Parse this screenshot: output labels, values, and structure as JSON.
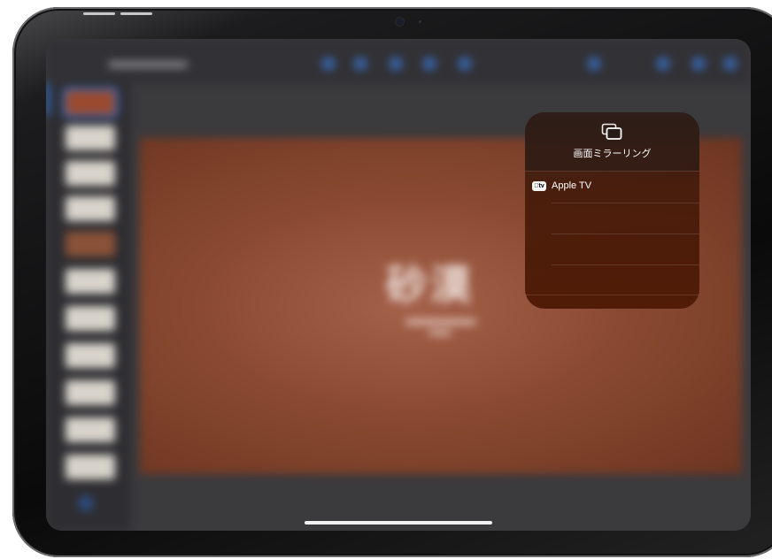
{
  "mirror_panel": {
    "title": "画面ミラーリング",
    "icon": "screen-mirroring-icon",
    "devices": [
      {
        "name": "Apple TV",
        "icon": "apple-tv-icon",
        "badge": "tv"
      }
    ]
  },
  "background_slide": {
    "title": "砂漠"
  },
  "colors": {
    "accent": "#2f7df0",
    "panel_bg": "#4e1a06",
    "slide_bg": "#8a4a31"
  }
}
